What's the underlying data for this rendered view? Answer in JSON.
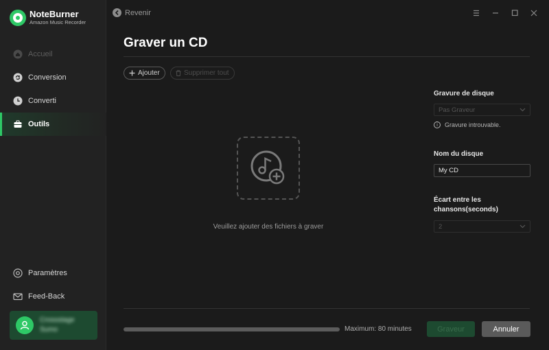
{
  "brand": {
    "name": "NoteBurner",
    "subtitle": "Amazon Music Recorder"
  },
  "sidebar": {
    "items": [
      {
        "label": "Accueil",
        "icon": "home-icon",
        "state": "disabled"
      },
      {
        "label": "Conversion",
        "icon": "refresh-icon",
        "state": "normal"
      },
      {
        "label": "Converti",
        "icon": "clock-icon",
        "state": "normal"
      },
      {
        "label": "Outils",
        "icon": "toolbox-icon",
        "state": "active"
      }
    ],
    "bottom_items": [
      {
        "label": "Paramètres",
        "icon": "gear-icon"
      },
      {
        "label": "Feed-Back",
        "icon": "mail-icon"
      }
    ],
    "user": {
      "line1": "Crossstage",
      "line2": "Sumo"
    }
  },
  "header": {
    "back_label": "Revenir"
  },
  "page": {
    "title": "Graver un CD"
  },
  "toolbar": {
    "add_label": "Ajouter",
    "delete_all_label": "Supprimer tout"
  },
  "dropzone": {
    "hint": "Veuillez ajouter des fichiers à graver"
  },
  "settings": {
    "burner_label": "Gravure de disque",
    "burner_value": "Pas Graveur",
    "burner_info": "Gravure introuvable.",
    "disc_name_label": "Nom du disque",
    "disc_name_value": "My CD",
    "gap_label_line1": "Écart entre les",
    "gap_label_line2": "chansons(seconds)",
    "gap_value": "2"
  },
  "footer": {
    "progress": 0,
    "max_text": "Maximum: 80 minutes",
    "burn_label": "Graveur",
    "cancel_label": "Annuler"
  },
  "colors": {
    "accent": "#2ec866",
    "accent_dark": "#1d4a30",
    "background": "#1b1b1b",
    "sidebar": "#222222"
  }
}
